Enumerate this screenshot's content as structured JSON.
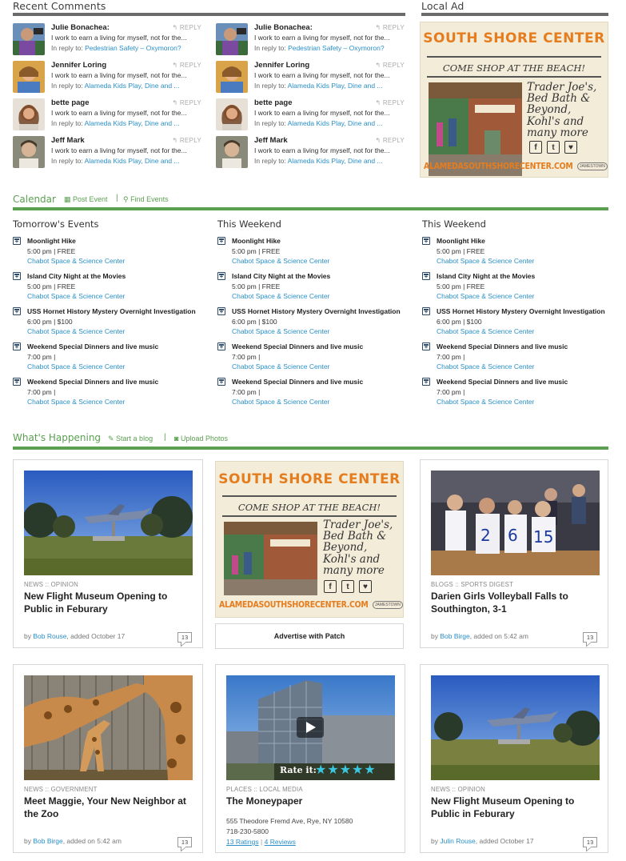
{
  "recent_comments": {
    "title": "Recent Comments",
    "reply_label": "REPLY",
    "in_reply_prefix": "In reply to:",
    "columns": [
      [
        {
          "name": "Julie Bonachea:",
          "text": "I work to earn a living for myself, not for the...",
          "reply_to": "Pedestrian Safety – Oxymoron?"
        },
        {
          "name": "Jennifer Loring",
          "text": "I work to earn a living for myself, not for the...",
          "reply_to": "Alameda Kids Play, Dine and ..."
        },
        {
          "name": "bette page",
          "text": "I work to earn a living for myself, not for the...",
          "reply_to": "Alameda Kids Play, Dine and ..."
        },
        {
          "name": "Jeff Mark",
          "text": "I work to earn a living for myself, not for the...",
          "reply_to": "Alameda Kids Play, Dine and ..."
        }
      ],
      [
        {
          "name": "Julie Bonachea:",
          "text": "I work to earn a living for myself, not for the...",
          "reply_to": "Pedestrian Safety – Oxymoron?"
        },
        {
          "name": "Jennifer Loring",
          "text": "I work to earn a living for myself, not for the...",
          "reply_to": "Alameda Kids Play, Dine and ..."
        },
        {
          "name": "bette page",
          "text": "I work to earn a living for myself, not for the...",
          "reply_to": "Alameda Kids Play, Dine and ..."
        },
        {
          "name": "Jeff Mark",
          "text": "I work to earn a living for myself, not for the...",
          "reply_to": "Alameda Kids Play, Dine and ..."
        }
      ]
    ]
  },
  "local_ad": {
    "title": "Local Ad"
  },
  "ad": {
    "brand": "SOUTH SHORE CENTER",
    "tagline": "COME SHOP AT THE BEACH!",
    "stores": [
      "Trader Joe's,",
      "Bed Bath &",
      "Beyond,",
      "Kohl's and",
      "many more"
    ],
    "url": "ALAMEDASOUTHSHORECENTER.COM",
    "logo_text": "JAMESTOWN",
    "social_icons": [
      "facebook-icon",
      "twitter-icon",
      "heart-icon"
    ],
    "accent_color": "#e57d1f",
    "background_color": "#f3ecd9"
  },
  "calendar": {
    "title": "Calendar",
    "post_event": "Post Event",
    "find_events": "Find Events",
    "columns": [
      {
        "heading": "Tomorrow's Events"
      },
      {
        "heading": "This Weekend"
      },
      {
        "heading": "This Weekend"
      }
    ],
    "events": [
      {
        "title": "Moonlight Hike",
        "time": "5:00 pm | FREE",
        "venue": "Chabot Space & Science Center"
      },
      {
        "title": "Island City Night at the Movies",
        "time": "5:00 pm | FREE",
        "venue": "Chabot Space & Science Center"
      },
      {
        "title": "USS Hornet History Mystery Overnight Investigation",
        "time": "6:00 pm | $100",
        "venue": "Chabot Space & Science Center"
      },
      {
        "title": "Weekend Special Dinners and live music",
        "time": "7:00 pm |",
        "venue": "Chabot Space & Science Center"
      },
      {
        "title": "Weekend Special Dinners and live music",
        "time": "7:00 pm |",
        "venue": "Chabot Space & Science Center"
      }
    ]
  },
  "whats_happening": {
    "title": "What's Happening",
    "start_blog": "Start a blog",
    "upload_photos": "Upload Photos",
    "advertise_label": "Advertise with Patch",
    "cards": [
      {
        "category": "NEWS :: OPINION",
        "headline": "New Flight Museum Opening to Public in Feburary",
        "by": "by",
        "author": "Bob Rouse",
        "added": ", added October 17",
        "count": "13"
      },
      {
        "category": "BLOGS :: SPORTS DIGEST",
        "headline": "Darien Girls Volleyball Falls to Southington, 3-1",
        "by": "by",
        "author": "Bob Birge",
        "added": ", added on 5:42 am",
        "count": "13"
      },
      {
        "category": "NEWS :: GOVERNMENT",
        "headline": "Meet Maggie, Your New Neighbor at the Zoo",
        "by": "by",
        "author": "Bob Birge",
        "added": ", added on 5:42 am",
        "count": "13"
      },
      {
        "category": "PLACES :: LOCAL MEDIA",
        "headline": "The Moneypaper",
        "address": "555 Theodore Fremd Ave, Rye, NY 10580",
        "phone": "718-230-5800",
        "ratings": "13 Ratings",
        "reviews": "4 Reviews",
        "rate_label": "Rate it:",
        "rating_stars": 5
      },
      {
        "category": "NEWS :: OPINION",
        "headline": "New Flight Museum Opening to Public in Feburary",
        "by": "by",
        "author": "Julin Rouse",
        "added": ", added October 17",
        "count": "13"
      }
    ]
  },
  "colors": {
    "green": "#5aa050",
    "link": "#2a8fc9",
    "gray_rule": "#6b6b6b"
  }
}
